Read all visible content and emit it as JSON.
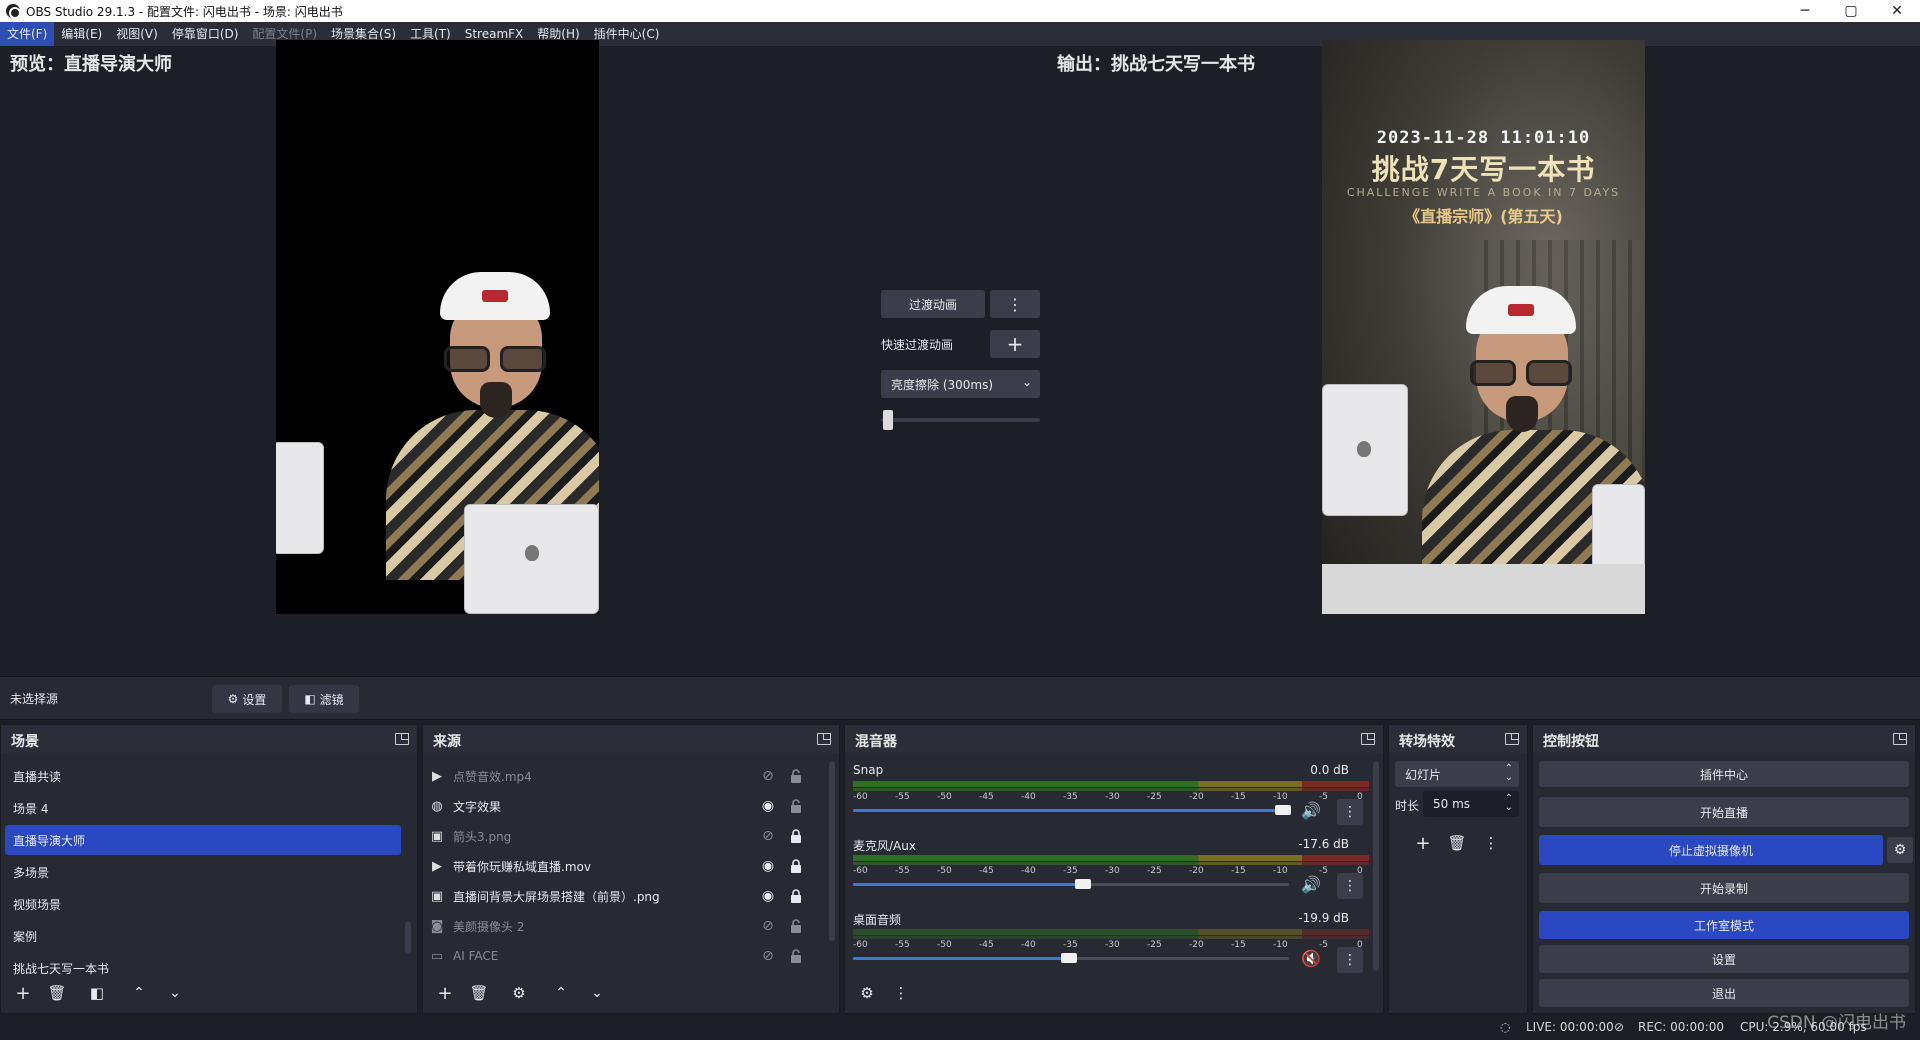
{
  "window": {
    "title": "OBS Studio 29.1.3 - 配置文件: 闪电出书 - 场景: 闪电出书",
    "minimize": "─",
    "maximize": "▢",
    "close": "✕"
  },
  "menu": {
    "items": [
      {
        "label": "文件(F)"
      },
      {
        "label": "编辑(E)"
      },
      {
        "label": "视图(V)"
      },
      {
        "label": "停靠窗口(D)"
      },
      {
        "label": "配置文件(P)"
      },
      {
        "label": "场景集合(S)"
      },
      {
        "label": "工具(T)"
      },
      {
        "label": "StreamFX"
      },
      {
        "label": "帮助(H)"
      },
      {
        "label": "插件中心(C)"
      }
    ]
  },
  "preview": {
    "label": "预览：直播导演大师"
  },
  "program": {
    "label": "输出：挑战七天写一本书",
    "datetime": "2023-11-28 11:01:10",
    "title": "挑战7天写一本书",
    "subtitle": "CHALLENGE WRITE A BOOK IN 7 DAYS",
    "book": "《直播宗师》(第五天)"
  },
  "transition": {
    "transition_button": "过渡动画",
    "quick_label": "快速过渡动画",
    "add": "+",
    "more": "⋮",
    "selected": "亮度擦除 (300ms)",
    "slider_value": 0
  },
  "context": {
    "no_source": "未选择源",
    "settings": "设置",
    "filters": "滤镜"
  },
  "scenes": {
    "title": "场景",
    "items": [
      "直播共读",
      "场景 4",
      "直播导演大师",
      "多场景",
      "视频场景",
      "案例",
      "挑战七天写一本书"
    ],
    "selected_index": 2
  },
  "sources": {
    "title": "来源",
    "items": [
      {
        "name": "点赞音效.mp4",
        "icon": "play-icon",
        "visible": false,
        "locked": false
      },
      {
        "name": "文字效果",
        "icon": "globe-icon",
        "visible": true,
        "locked": false
      },
      {
        "name": "箭头3.png",
        "icon": "image-icon",
        "visible": false,
        "locked": true
      },
      {
        "name": "带着你玩赚私域直播.mov",
        "icon": "play-icon",
        "visible": true,
        "locked": true
      },
      {
        "name": "直播间背景大屏场景搭建（前景）.png",
        "icon": "image-icon",
        "visible": true,
        "locked": true
      },
      {
        "name": "美颜摄像头 2",
        "icon": "camera-icon",
        "visible": false,
        "locked": false
      },
      {
        "name": "AI FACE",
        "icon": "window-icon",
        "visible": false,
        "locked": false
      }
    ]
  },
  "mixer": {
    "title": "混音器",
    "ticks": [
      "-60",
      "-55",
      "-50",
      "-45",
      "-40",
      "-35",
      "-30",
      "-25",
      "-20",
      "-15",
      "-10",
      "-5",
      "0"
    ],
    "channels": [
      {
        "name": "Snap",
        "db": "0.0 dB",
        "volume": 1.0,
        "muted": false
      },
      {
        "name": "麦克风/Aux",
        "db": "-17.6 dB",
        "volume": 0.43,
        "muted": false
      },
      {
        "name": "桌面音频",
        "db": "-19.9 dB",
        "volume": 0.41,
        "muted": true
      }
    ]
  },
  "transitions_dock": {
    "title": "转场特效",
    "type": "幻灯片",
    "duration_label": "时长",
    "duration": "50 ms"
  },
  "controls": {
    "title": "控制按钮",
    "plugin_center": "插件中心",
    "start_streaming": "开始直播",
    "stop_virtualcam": "停止虚拟摄像机",
    "start_recording": "开始录制",
    "studio_mode": "工作室模式",
    "settings": "设置",
    "exit": "退出"
  },
  "status": {
    "live": "LIVE: 00:00:00",
    "rec": "REC: 00:00:00",
    "cpu": "CPU: 2.9%, 60.00 fps"
  },
  "watermark": "CSDN @闪电出书",
  "colors": {
    "accent": "#2a48c2",
    "background": "#1d1f26",
    "panel": "#272a33"
  }
}
